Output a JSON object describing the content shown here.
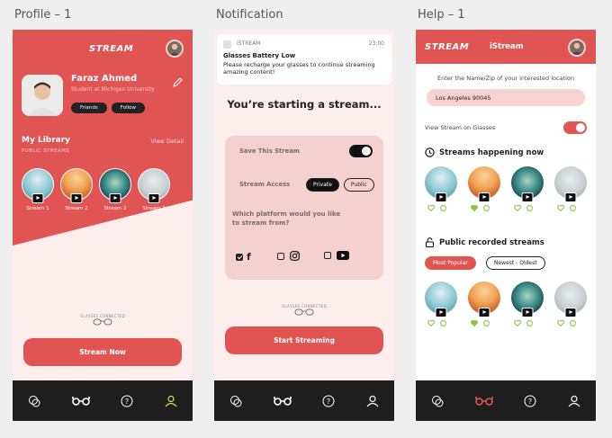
{
  "frames": {
    "profile_label": "Profile – 1",
    "notification_label": "Notification",
    "help_label": "Help – 1"
  },
  "brand": {
    "logo": "STREAM",
    "app_name": "iStream",
    "accent": "#e05553",
    "nav_bg": "#1e1e1e"
  },
  "profile": {
    "name": "Faraz Ahmed",
    "subtitle": "Student at Michigan University",
    "friends_label": "Friends",
    "follow_label": "Follow",
    "library_title": "My Library",
    "library_sub": "PUBLIC STREAMS",
    "view_detail": "View Detail",
    "streams": [
      {
        "label": "Stream 1",
        "icon": "play-icon"
      },
      {
        "label": "Stream 2",
        "icon": "play-icon"
      },
      {
        "label": "Stream 2",
        "icon": "play-icon"
      },
      {
        "label": "Stream 3",
        "icon": "play-icon"
      }
    ],
    "glasses_status": "GLASSES CONNECTED",
    "stream_now": "Stream Now"
  },
  "notification": {
    "app": "ISTREAM",
    "time": "23:00",
    "title": "Glasses Battery Low",
    "body": "Please recharge your glasses to continue streaming amazing content!",
    "heading": "You’re starting a stream...",
    "save_label": "Save This Stream",
    "save_on": true,
    "access_label": "Stream Access",
    "access_options": [
      "Private",
      "Public"
    ],
    "access_selected": "Private",
    "platform_question": "Which platform would you like to stream from?",
    "platforms": [
      {
        "icon": "facebook-icon",
        "checked": true
      },
      {
        "icon": "instagram-icon",
        "checked": false
      },
      {
        "icon": "youtube-icon",
        "checked": false
      }
    ],
    "glasses_status": "GLASSES CONNECTED",
    "start_label": "Start Streaming"
  },
  "help": {
    "instruction": "Enter the Name/Zip of your interested location",
    "search_value": "Los Angeles 90045",
    "view_on_glasses": "View Stream on Glasses",
    "view_on": true,
    "happening_title": "Streams happening now",
    "recorded_title": "Public recorded streams",
    "filters": [
      "Most Popular",
      "Newest - Oldest"
    ],
    "filter_selected": "Most Popular"
  },
  "nav": [
    {
      "icon": "chat-icon"
    },
    {
      "icon": "glasses-icon"
    },
    {
      "icon": "help-icon"
    },
    {
      "icon": "profile-icon"
    }
  ],
  "nav_active": {
    "profile": "profile-icon",
    "notification": "",
    "help": "glasses-icon"
  },
  "nav_active_colors": {
    "profile": "#e8d94a",
    "help": "#e05553"
  }
}
